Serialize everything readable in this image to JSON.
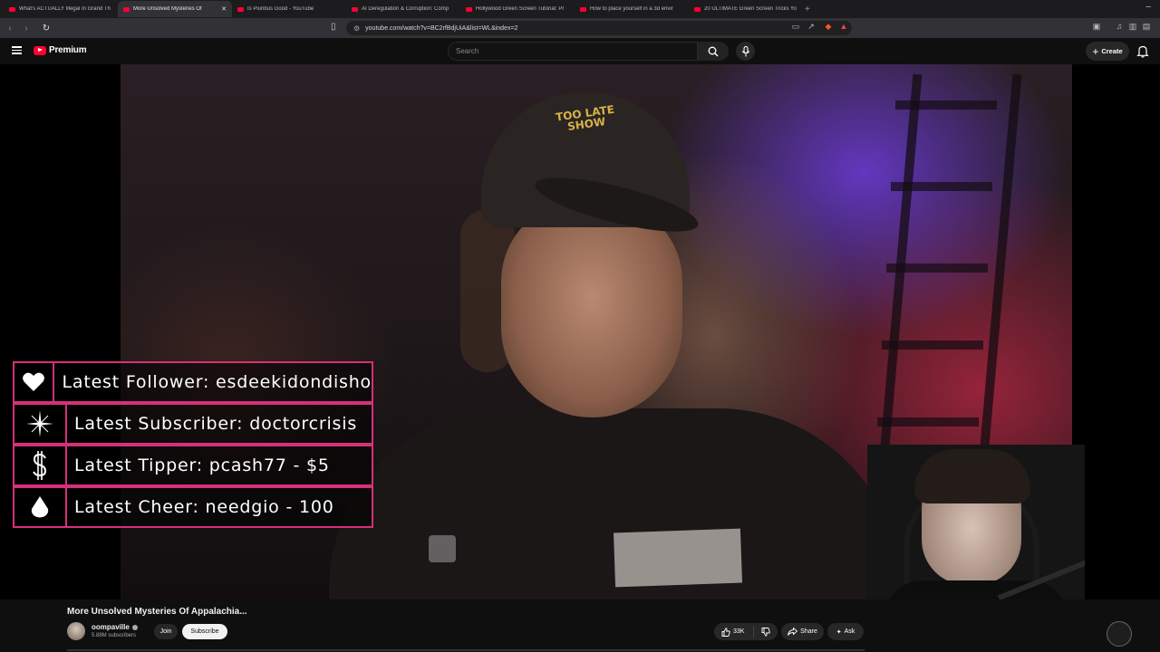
{
  "browser": {
    "tabs": [
      {
        "title": "What's ACTUALLY Illegal In Grand Th",
        "active": false
      },
      {
        "title": "More Unsolved Mysteries Of",
        "active": true
      },
      {
        "title": "Is Pluribus Good - YouTube",
        "active": false
      },
      {
        "title": "AI Deregulation & Corruption: Comp",
        "active": false
      },
      {
        "title": "Hollywood Green Screen Tutorial: Pr",
        "active": false
      },
      {
        "title": "How to place yourself in a 3d envir",
        "active": false
      },
      {
        "title": "20 ULTIMATE Green Screen Tricks Yo",
        "active": false
      }
    ],
    "url": "youtube.com/watch?v=BC2rfBdjUiA&list=WL&index=2"
  },
  "masthead": {
    "logo_label": "Premium",
    "search_placeholder": "Search",
    "create_label": "Create"
  },
  "overlay": {
    "alerts": [
      {
        "icon": "heart-icon",
        "text": "Latest Follower: esdeekidondisho"
      },
      {
        "icon": "sparkle-icon",
        "text": "Latest Subscriber: doctorcrisis"
      },
      {
        "icon": "dollar-icon",
        "text": "Latest Tipper: pcash77 - $5"
      },
      {
        "icon": "diamond-icon",
        "text": "Latest Cheer: needgio - 100"
      }
    ],
    "accent_color": "#d6307a",
    "hat_text": "TOO LATE SHOW"
  },
  "video": {
    "title": "More Unsolved Mysteries Of Appalachia...",
    "channel": "oompaville",
    "subscribers": "5.88M subscribers",
    "join_label": "Join",
    "subscribe_label": "Subscribe",
    "likes": "33K",
    "share_label": "Share",
    "ask_label": "Ask"
  }
}
